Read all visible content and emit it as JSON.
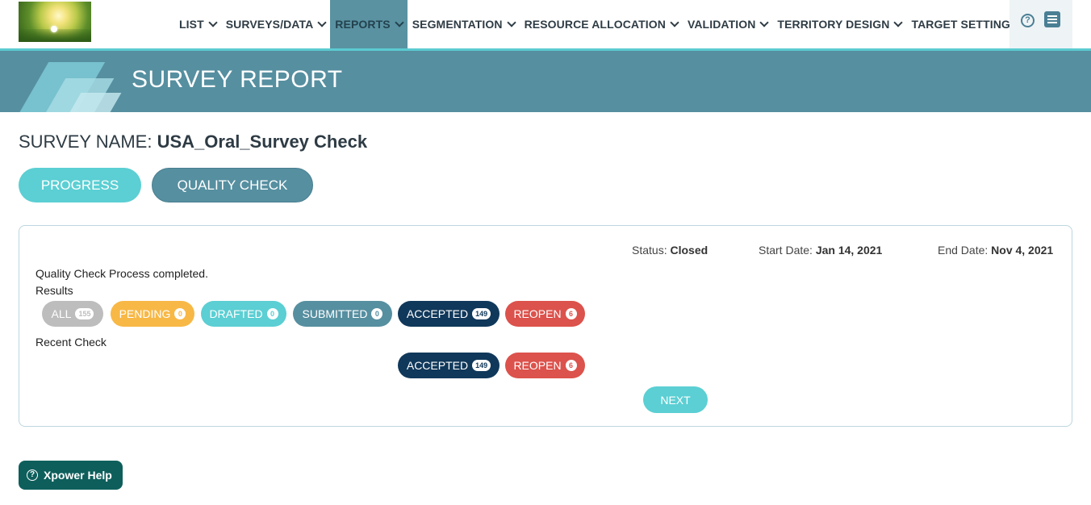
{
  "nav": {
    "items": [
      {
        "label": "LIST"
      },
      {
        "label": "SURVEYS/DATA"
      },
      {
        "label": "REPORTS"
      },
      {
        "label": "SEGMENTATION"
      },
      {
        "label": "RESOURCE ALLOCATION"
      },
      {
        "label": "VALIDATION"
      },
      {
        "label": "TERRITORY DESIGN"
      },
      {
        "label": "TARGET SETTING"
      }
    ],
    "active": "REPORTS",
    "help_symbol": "?"
  },
  "banner": {
    "title": "SURVEY REPORT"
  },
  "survey": {
    "label": "SURVEY NAME:",
    "name": "USA_Oral_Survey Check"
  },
  "tabs": {
    "progress": "PROGRESS",
    "quality": "QUALITY CHECK"
  },
  "panel": {
    "status_label": "Status:",
    "status_value": "Closed",
    "start_label": "Start Date:",
    "start_value": "Jan 14, 2021",
    "end_label": "End Date:",
    "end_value": "Nov 4, 2021",
    "message": "Quality Check Process completed.",
    "results_label": "Results",
    "results": [
      {
        "label": "ALL",
        "count": "155"
      },
      {
        "label": "PENDING",
        "count": "0"
      },
      {
        "label": "DRAFTED",
        "count": "0"
      },
      {
        "label": "SUBMITTED",
        "count": "0"
      },
      {
        "label": "ACCEPTED",
        "count": "149"
      },
      {
        "label": "REOPEN",
        "count": "6"
      }
    ],
    "recent_label": "Recent Check",
    "recent": [
      {
        "label": "ACCEPTED",
        "count": "149"
      },
      {
        "label": "REOPEN",
        "count": "6"
      }
    ],
    "next_label": "NEXT"
  },
  "help_button": {
    "label": "Xpower Help",
    "symbol": "?"
  },
  "colors": {
    "accent_teal": "#5bcfd3",
    "banner": "#568fa0",
    "pending": "#f8b846",
    "accepted": "#10385a",
    "reopen": "#dc524c",
    "all": "#bdbdbd"
  },
  "icons": [
    "logo-image",
    "help-icon",
    "menu-icon",
    "chevron-down-icon",
    "question-icon"
  ]
}
